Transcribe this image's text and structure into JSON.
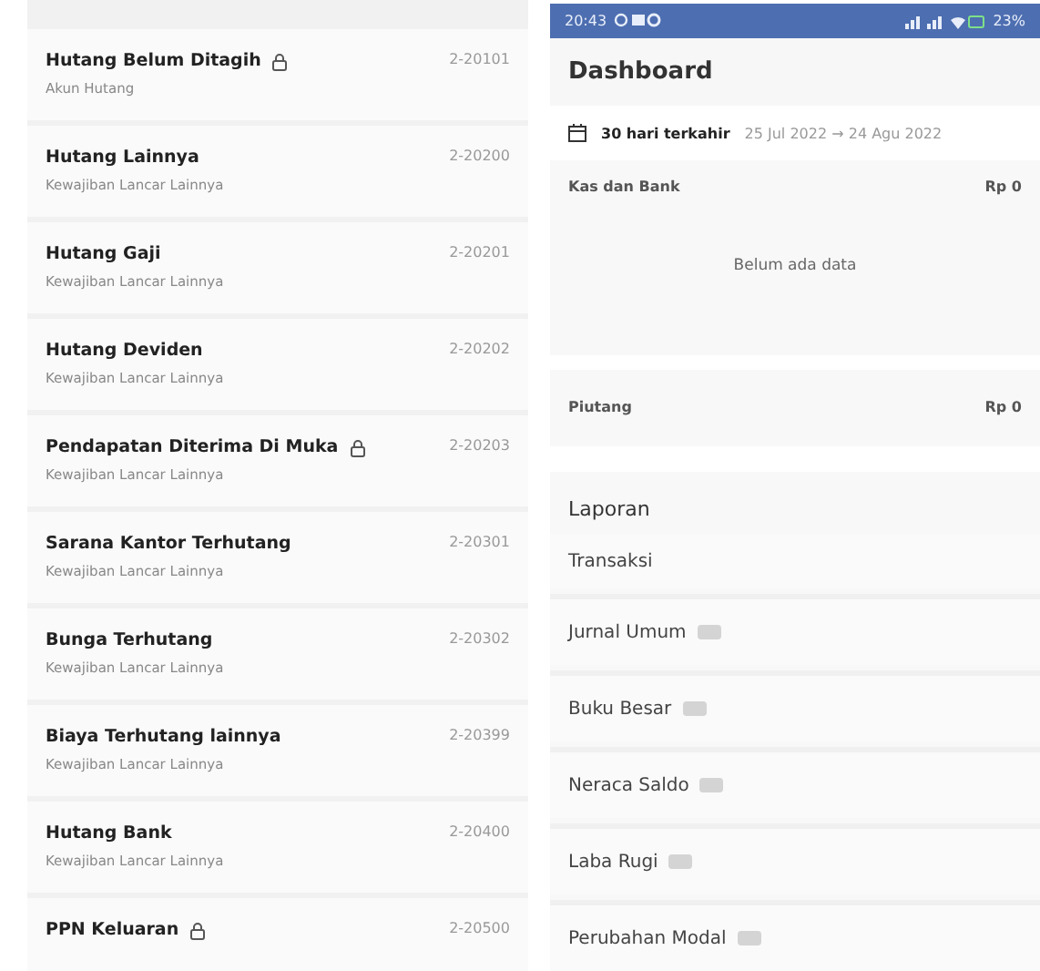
{
  "accounts": [
    {
      "name": "Hutang Belum Ditagih",
      "locked": true,
      "code": "2-20101",
      "category": "Akun Hutang"
    },
    {
      "name": "Hutang Lainnya",
      "locked": false,
      "code": "2-20200",
      "category": "Kewajiban Lancar Lainnya"
    },
    {
      "name": "Hutang Gaji",
      "locked": false,
      "code": "2-20201",
      "category": "Kewajiban Lancar Lainnya"
    },
    {
      "name": "Hutang Deviden",
      "locked": false,
      "code": "2-20202",
      "category": "Kewajiban Lancar Lainnya"
    },
    {
      "name": "Pendapatan Diterima Di Muka",
      "locked": true,
      "code": "2-20203",
      "category": "Kewajiban Lancar Lainnya"
    },
    {
      "name": "Sarana Kantor Terhutang",
      "locked": false,
      "code": "2-20301",
      "category": "Kewajiban Lancar Lainnya"
    },
    {
      "name": "Bunga Terhutang",
      "locked": false,
      "code": "2-20302",
      "category": "Kewajiban Lancar Lainnya"
    },
    {
      "name": "Biaya Terhutang lainnya",
      "locked": false,
      "code": "2-20399",
      "category": "Kewajiban Lancar Lainnya"
    },
    {
      "name": "Hutang Bank",
      "locked": false,
      "code": "2-20400",
      "category": "Kewajiban Lancar Lainnya"
    },
    {
      "name": "PPN Keluaran",
      "locked": true,
      "code": "2-20500"
    }
  ],
  "status_bar": {
    "time": "20:43",
    "battery": "23%"
  },
  "dashboard": {
    "title": "Dashboard",
    "period": "30 hari terkahir",
    "range": "25 Jul 2022 → 24 Agu 2022",
    "cash": {
      "label": "Kas dan Bank",
      "amount": "Rp 0",
      "empty": "Belum ada data"
    },
    "receivable": {
      "label": "Piutang",
      "amount": "Rp 0"
    }
  },
  "reports": {
    "title": "Laporan",
    "items": [
      {
        "label": "Transaksi",
        "badge": false
      },
      {
        "label": "Jurnal Umum",
        "badge": true
      },
      {
        "label": "Buku Besar",
        "badge": true
      },
      {
        "label": "Neraca Saldo",
        "badge": true
      },
      {
        "label": "Laba Rugi",
        "badge": true
      },
      {
        "label": "Perubahan Modal",
        "badge": true
      }
    ]
  }
}
